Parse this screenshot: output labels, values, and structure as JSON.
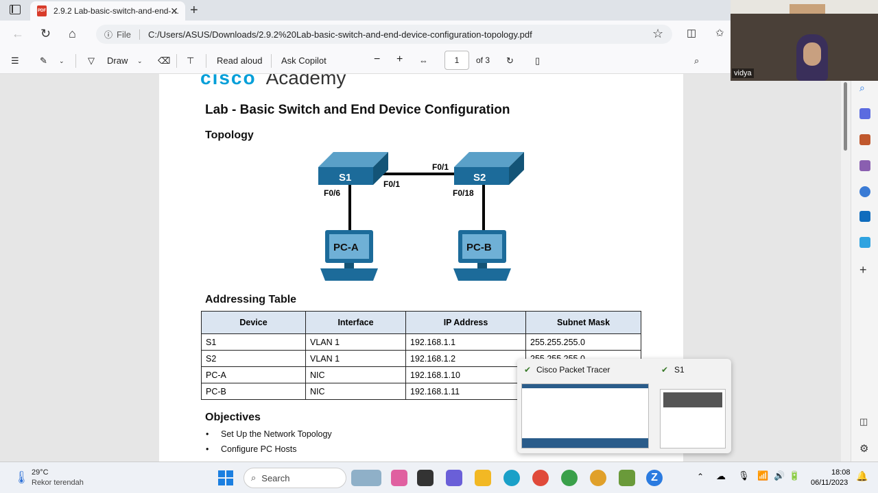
{
  "browser": {
    "tab_title": "2.9.2 Lab-basic-switch-and-end-…",
    "file_label": "File",
    "url": "C:/Users/ASUS/Downloads/2.9.2%20Lab-basic-switch-and-end-device-configuration-topology.pdf"
  },
  "pdf_toolbar": {
    "draw": "Draw",
    "read_aloud": "Read aloud",
    "ask_copilot": "Ask Copilot",
    "page": "1",
    "of_pages": "of 3"
  },
  "document": {
    "logo_cisco": "cisco",
    "logo_academy": "Academy",
    "title": "Lab - Basic Switch and End Device Configuration",
    "topology_heading": "Topology",
    "topology": {
      "s1": "S1",
      "s2": "S2",
      "pca": "PC-A",
      "pcb": "PC-B",
      "s1_f01": "F0/1",
      "s2_f01": "F0/1",
      "s1_f06": "F0/6",
      "s2_f018": "F0/18"
    },
    "addressing_heading": "Addressing Table",
    "table_headers": [
      "Device",
      "Interface",
      "IP Address",
      "Subnet Mask"
    ],
    "rows": [
      [
        "S1",
        "VLAN 1",
        "192.168.1.1",
        "255.255.255.0"
      ],
      [
        "S2",
        "VLAN 1",
        "192.168.1.2",
        "255.255.255.0"
      ],
      [
        "PC-A",
        "NIC",
        "192.168.1.10",
        ""
      ],
      [
        "PC-B",
        "NIC",
        "192.168.1.11",
        ""
      ]
    ],
    "objectives_heading": "Objectives",
    "objectives": [
      "Set Up the Network Topology",
      "Configure PC Hosts"
    ]
  },
  "popup": {
    "left": "Cisco Packet Tracer",
    "right": "S1"
  },
  "webcam": {
    "name": "vidya"
  },
  "taskbar": {
    "temp": "29°C",
    "weather": "Rekor terendah",
    "search": "Search",
    "time": "18:08",
    "date": "06/11/2023"
  }
}
